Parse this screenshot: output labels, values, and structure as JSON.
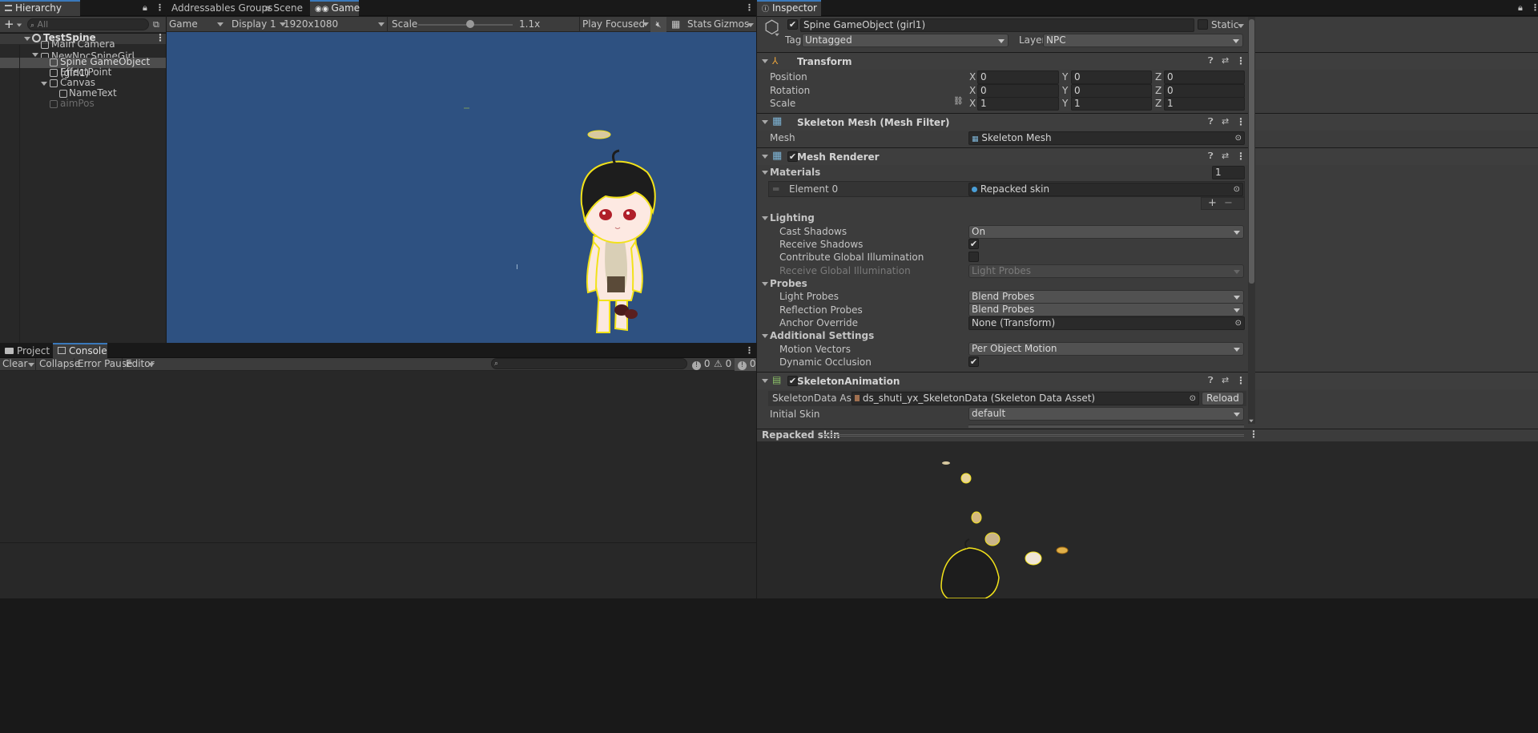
{
  "hierarchy": {
    "tab_label": "Hierarchy",
    "search_placeholder": "All",
    "add_label": "+",
    "scene_name": "TestSpine",
    "items": [
      {
        "label": "Main Camera"
      },
      {
        "label": "NewNpcSpineGirl"
      },
      {
        "label": "Spine GameObject (girl1)"
      },
      {
        "label": "EffectPoint"
      },
      {
        "label": "Canvas"
      },
      {
        "label": "NameText"
      },
      {
        "label": "aimPos"
      }
    ]
  },
  "center_tabs": {
    "addressables": "Addressables Groups",
    "scene": "Scene",
    "game": "Game"
  },
  "game_toolbar": {
    "mode": "Game",
    "display": "Display 1",
    "resolution": "1920x1080",
    "scale_label": "Scale",
    "scale_value": "1.1x",
    "play_focused": "Play Focused",
    "stats": "Stats",
    "gizmos": "Gizmos",
    "scale_slider_fraction": 0.55
  },
  "console": {
    "project_tab": "Project",
    "console_tab": "Console",
    "clear": "Clear",
    "collapse": "Collapse",
    "error_pause": "Error Pause",
    "editor": "Editor",
    "log_count": "0",
    "warn_count": "0",
    "error_count": "0"
  },
  "inspector": {
    "tab_label": "Inspector",
    "object_name": "Spine GameObject (girl1)",
    "static_label": "Static",
    "tag_label": "Tag",
    "tag_value": "Untagged",
    "layer_label": "Layer",
    "layer_value": "NPC",
    "transform": {
      "title": "Transform",
      "position_label": "Position",
      "rotation_label": "Rotation",
      "scale_label": "Scale",
      "position": [
        "0",
        "0",
        "0"
      ],
      "rotation": [
        "0",
        "0",
        "0"
      ],
      "scale": [
        "1",
        "1",
        "1"
      ],
      "x": "X",
      "y": "Y",
      "z": "Z"
    },
    "mesh_filter": {
      "title": "Skeleton Mesh (Mesh Filter)",
      "mesh_label": "Mesh",
      "mesh_value": "Skeleton Mesh"
    },
    "mesh_renderer": {
      "title": "Mesh Renderer",
      "materials_label": "Materials",
      "materials_count": "1",
      "element0_label": "Element 0",
      "element0_value": "Repacked skin",
      "plus": "+",
      "minus": "−",
      "lighting_label": "Lighting",
      "cast_shadows_label": "Cast Shadows",
      "cast_shadows_value": "On",
      "receive_shadows_label": "Receive Shadows",
      "contribute_gi_label": "Contribute Global Illumination",
      "receive_gi_label": "Receive Global Illumination",
      "receive_gi_value": "Light Probes",
      "probes_label": "Probes",
      "light_probes_label": "Light Probes",
      "light_probes_value": "Blend Probes",
      "reflection_probes_label": "Reflection Probes",
      "reflection_probes_value": "Blend Probes",
      "anchor_override_label": "Anchor Override",
      "anchor_override_value": "None (Transform)",
      "additional_label": "Additional Settings",
      "motion_vectors_label": "Motion Vectors",
      "motion_vectors_value": "Per Object Motion",
      "dynamic_occlusion_label": "Dynamic Occlusion"
    },
    "skeleton_animation": {
      "title": "SkeletonAnimation",
      "data_asset_label": "SkeletonData Asset",
      "data_asset_value": "ds_shuti_yx_SkeletonData (Skeleton Data Asset)",
      "reload": "Reload",
      "initial_skin_label": "Initial Skin",
      "initial_skin_value": "default"
    },
    "preview_title": "Repacked skin"
  },
  "colors": {
    "game_bg": "#2e5181",
    "accent": "#3a79bb",
    "outline_yellow": "#f2e21a"
  }
}
